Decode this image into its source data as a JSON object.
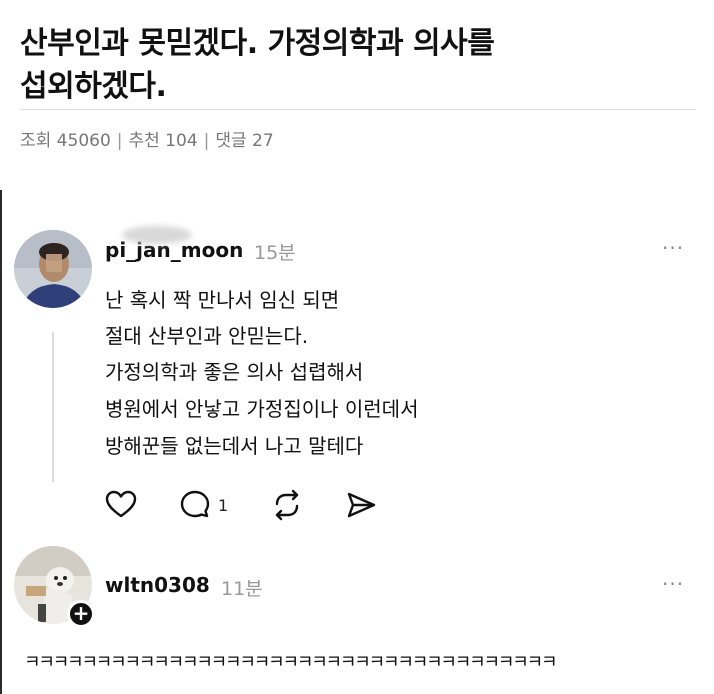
{
  "post": {
    "title_line1": "산부인과 못믿겠다. 가정의학과 의사를",
    "title_line2": "섭외하겠다.",
    "meta": {
      "views": "조회 45060",
      "recommend": "추천 104",
      "comments": "댓글 27"
    }
  },
  "comments": [
    {
      "username": "pi_jan_moon",
      "time": "15분",
      "more": "···",
      "lines": [
        "난 혹시 짝 만나서 임신 되면",
        "절대 산부인과 안믿는다.",
        "가정의학과 좋은 의사 섭렵해서",
        "병원에서 안낳고 가정집이나 이런데서",
        "방해꾼들 없는데서 나고 말테다"
      ],
      "reply_count": "1",
      "icons": [
        "heart-icon",
        "speech-bubble-icon",
        "repost-icon",
        "send-icon"
      ]
    },
    {
      "username": "wltn0308",
      "time": "11분",
      "more": "···",
      "follow": "+",
      "lines": [
        "ㅋㅋㅋㅋㅋㅋㅋㅋㅋㅋㅋㅋㅋㅋㅋㅋㅋㅋㅋㅋㅋㅋㅋㅋㅋㅋㅋㅋㅋㅋㅋㅋㅋㅋㅋㅋㅋ"
      ]
    }
  ]
}
